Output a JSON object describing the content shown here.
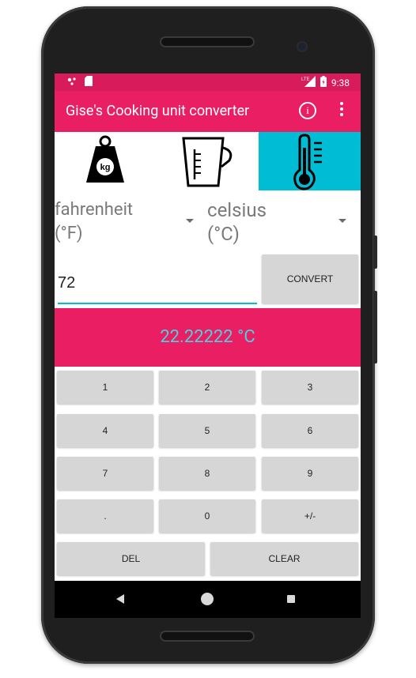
{
  "status_bar": {
    "time": "9:38",
    "left_icons": [
      "notification-dots-icon",
      "sd-card-icon"
    ],
    "right_icons": [
      "lte-signal-icon",
      "battery-charging-icon"
    ],
    "lte_label": "LTE"
  },
  "app_bar": {
    "title": "Gise's Cooking unit converter",
    "info_label": "i",
    "menu_icon": "more-vert-icon",
    "background": "#e91e63"
  },
  "tabs": [
    {
      "name": "weight",
      "icon": "kg-weight-icon",
      "icon_label": "kg",
      "active": false
    },
    {
      "name": "volume",
      "icon": "measuring-cup-icon",
      "active": false
    },
    {
      "name": "temperature",
      "icon": "thermometer-icon",
      "active": true
    }
  ],
  "converter": {
    "from_unit": "fahrenheit\n(°F)",
    "to_unit": "celsius\n(°C)",
    "input_value": "72",
    "convert_label": "CONVERT",
    "result": "22.22222 °C",
    "result_color": "#4dd0e1"
  },
  "keypad": {
    "keys": [
      "1",
      "2",
      "3",
      "4",
      "5",
      "6",
      "7",
      "8",
      "9",
      ".",
      "0",
      "+/-"
    ],
    "del_label": "DEL",
    "clear_label": "CLEAR"
  },
  "nav_bar": {
    "icons": [
      "back-icon",
      "home-icon",
      "recents-icon"
    ]
  },
  "colors": {
    "accent": "#00bcd4",
    "primary": "#e91e63",
    "primary_dark": "#d81b5a"
  }
}
